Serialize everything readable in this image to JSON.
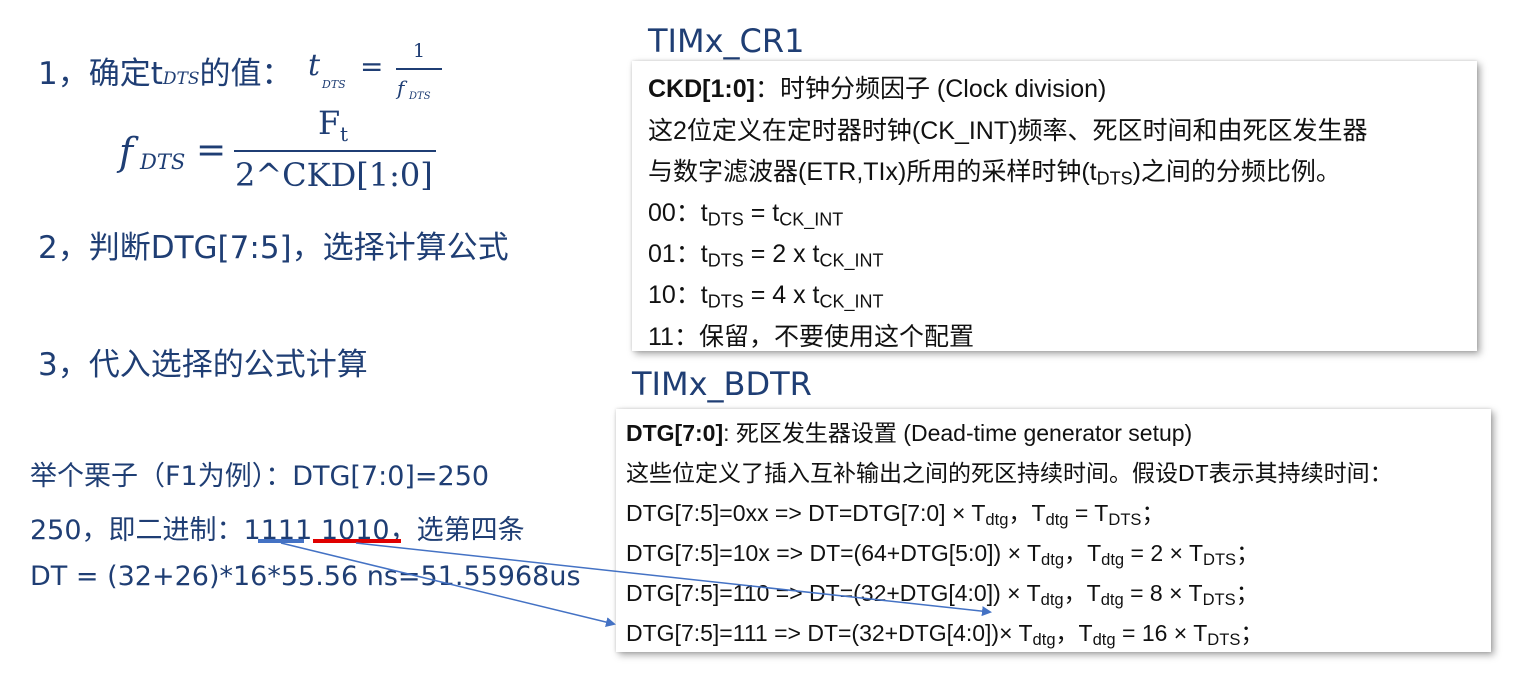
{
  "left": {
    "step1_label": "1，确定t",
    "step1_sub": "DTS",
    "step1_suffix": "的值：",
    "formula1": {
      "lhs": "t",
      "lhs_sub": "DTS",
      "eq": "=",
      "numerator": "1",
      "den": "f",
      "den_sub": "DTS"
    },
    "formula2": {
      "lhs": "f",
      "lhs_sub": "DTS",
      "eq": "=",
      "numerator": "F",
      "numerator_sub": "t",
      "denominator": "2^CKD[1:0]"
    },
    "step2": "2，判断DTG[7:5]，选择计算公式",
    "step3": "3，代入选择的公式计算",
    "example_line1": "举个栗子（F1为例）：DTG[7:0]=250",
    "example_line2_prefix": "250，即二进制：",
    "example_bits_a": "1111",
    "example_bits_b": "1010",
    "example_line2_suffix": "，选第四条",
    "example_line3": "DT = (32+26)*16*55.56 ns=51.55968us"
  },
  "cr1": {
    "title": "TIMx_CR1",
    "head_bold": "CKD[1:0]",
    "head_rest": "：时钟分频因子 (Clock division)",
    "desc1": "这2位定义在定时器时钟(CK_INT)频率、死区时间和由死区发生器",
    "desc2_a": "与数字滤波器(ETR,TIx)所用的采样时钟(t",
    "desc2_sub": "DTS",
    "desc2_b": ")之间的分频比例。",
    "rows": [
      {
        "code": "00：t",
        "sub1": "DTS",
        "mid": " = t",
        "sub2": "CK_INT"
      },
      {
        "code": "01：t",
        "sub1": "DTS",
        "mid": " = 2 x t",
        "sub2": "CK_INT"
      },
      {
        "code": "10：t",
        "sub1": "DTS",
        "mid": " = 4 x t",
        "sub2": "CK_INT"
      }
    ],
    "row_reserved": "11：保留，不要使用这个配置"
  },
  "bdtr": {
    "title": "TIMx_BDTR",
    "head_bold": "DTG[7:0]",
    "head_rest": ": 死区发生器设置 (Dead-time generator setup)",
    "desc": "这些位定义了插入互补输出之间的死区持续时间。假设DT表示其持续时间：",
    "rows": [
      {
        "a": "DTG[7:5]=0xx => DT=DTG[7:0] × T",
        "b": "，T",
        "c": " = T",
        "d": "；"
      },
      {
        "a": "DTG[7:5]=10x => DT=(64+DTG[5:0]) × T",
        "b": "，T",
        "c": " = 2 × T",
        "d": "；"
      },
      {
        "a": "DTG[7:5]=110 => DT=(32+DTG[4:0]) × T",
        "b": "，T",
        "c": " = 8 × T",
        "d": "；"
      },
      {
        "a": "DTG[7:5]=111 => DT=(32+DTG[4:0])× T",
        "b": "，T",
        "c": " = 16 × T",
        "d": "；"
      }
    ],
    "sub_dtg": "dtg",
    "sub_dts": "DTS"
  },
  "colors": {
    "text_blue": "#1f3e74",
    "underline_blue": "#4472c4",
    "underline_red": "#e00000",
    "arrow": "#4472c4"
  }
}
